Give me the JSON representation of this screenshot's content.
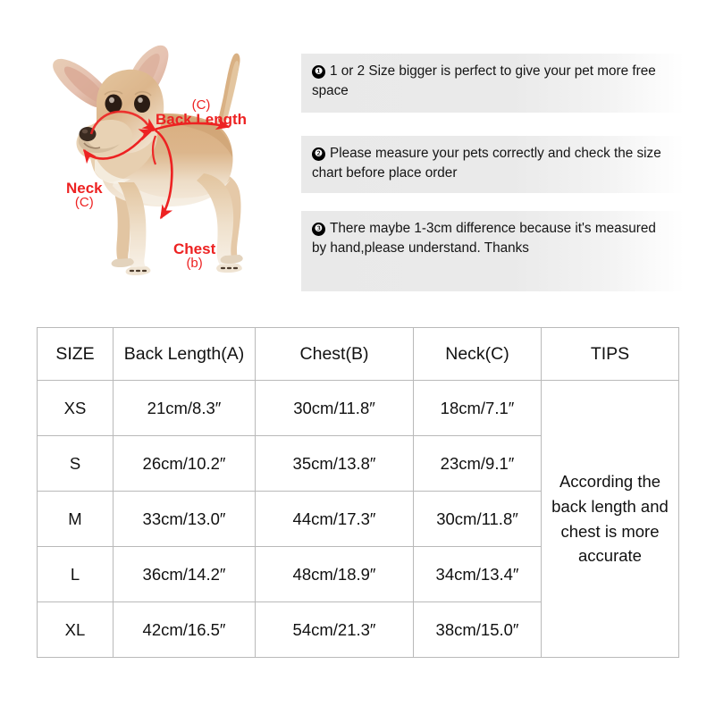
{
  "diagram": {
    "title": "chihuahua-measurement-diagram",
    "accent_color": "#ed2222",
    "fur_colors": {
      "light": "#f0dcc2",
      "mid": "#d9b389",
      "dark": "#c0925f",
      "shadow": "#a97a4c",
      "ear_inner": "#e8c4b6",
      "muzzle": "#8a6a50",
      "nose": "#3d2c22",
      "eye": "#2b1d16"
    },
    "labels": {
      "back_length": {
        "main": "Back Length",
        "sub": "(C)"
      },
      "neck": {
        "main": "Neck",
        "sub": "(C)"
      },
      "chest": {
        "main": "Chest",
        "sub": "(b)"
      }
    }
  },
  "notes": [
    {
      "number": "❶",
      "text": "1 or 2 Size bigger is perfect to give your pet more free space"
    },
    {
      "number": "❷",
      "text": "Please measure your pets correctly and check the size chart before place order"
    },
    {
      "number": "❸",
      "text": "There maybe 1-3cm difference because it's measured by hand,please understand. Thanks"
    }
  ],
  "size_chart": {
    "headers": [
      "SIZE",
      "Back Length(A)",
      "Chest(B)",
      "Neck(C)",
      "TIPS"
    ],
    "tips_text": "According the back length and chest is more accurate",
    "rows": [
      {
        "size": "XS",
        "back_length": "21cm/8.3″",
        "chest": "30cm/11.8″",
        "neck": "18cm/7.1″"
      },
      {
        "size": "S",
        "back_length": "26cm/10.2″",
        "chest": "35cm/13.8″",
        "neck": "23cm/9.1″"
      },
      {
        "size": "M",
        "back_length": "33cm/13.0″",
        "chest": "44cm/17.3″",
        "neck": "30cm/11.8″"
      },
      {
        "size": "L",
        "back_length": "36cm/14.2″",
        "chest": "48cm/18.9″",
        "neck": "34cm/13.4″"
      },
      {
        "size": "XL",
        "back_length": "42cm/16.5″",
        "chest": "54cm/21.3″",
        "neck": "38cm/15.0″"
      }
    ]
  }
}
